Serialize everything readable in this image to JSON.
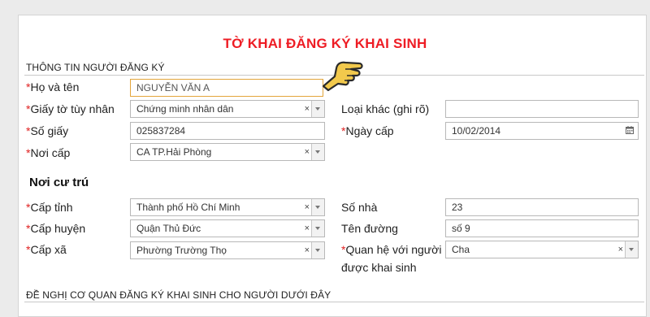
{
  "form": {
    "title": "TỜ KHAI ĐĂNG KÝ KHAI SINH",
    "section_registrant": "THÔNG TIN NGƯỜI ĐĂNG KÝ",
    "section_residence": "Nơi cư trú",
    "section_request": "ĐỀ NGHỊ CƠ QUAN ĐĂNG KÝ KHAI SINH CHO NGƯỜI DƯỚI ĐÂY",
    "required_mark": "*"
  },
  "fields": {
    "full_name": {
      "label": "Họ và tên",
      "value": "NGUYỄN VĂN A"
    },
    "id_type": {
      "label": "Giấy tờ tùy nhân",
      "value": "Chứng minh nhân dân"
    },
    "other_type": {
      "label": "Loại khác (ghi rõ)",
      "value": ""
    },
    "id_number": {
      "label": "Số giấy",
      "value": "025837284"
    },
    "issue_date": {
      "label": "Ngày cấp",
      "value": "10/02/2014"
    },
    "issue_place": {
      "label": "Nơi cấp",
      "value": "CA TP.Hải Phòng"
    },
    "province": {
      "label": "Cấp tỉnh",
      "value": "Thành phố Hồ Chí Minh"
    },
    "house_number": {
      "label": "Số nhà",
      "value": "23"
    },
    "district": {
      "label": "Cấp huyện",
      "value": "Quận Thủ Đức"
    },
    "street": {
      "label": "Tên đường",
      "value": "số 9"
    },
    "ward": {
      "label": "Cấp xã",
      "value": "Phường Trường Thọ"
    },
    "relationship": {
      "label": "Quan hệ với người được khai sinh",
      "value": "Cha"
    }
  },
  "icons": {
    "clear": "×",
    "dropdown": "chevron-down-icon",
    "calendar": "calendar-icon",
    "pointer": "pointing-hand-icon"
  },
  "colors": {
    "title": "#ee1c24",
    "required": "#e02020",
    "active_border": "#e3a53b",
    "hand": "#f2c94c"
  }
}
